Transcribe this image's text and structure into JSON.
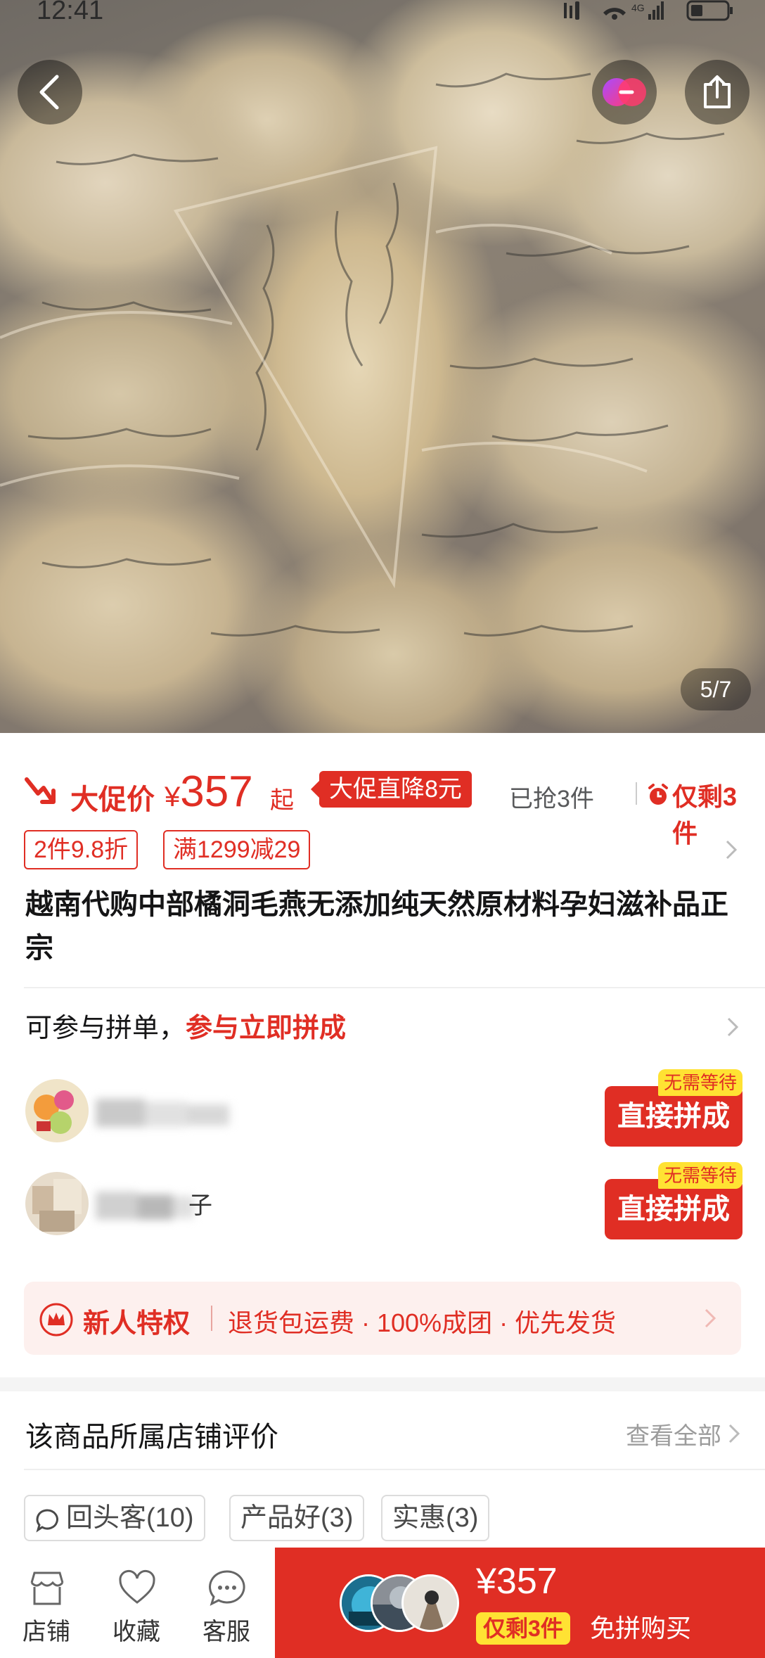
{
  "status_bar": {
    "time": "12:41"
  },
  "hero": {
    "page_indicator": "5/7"
  },
  "price": {
    "label": "大促价",
    "currency": "¥",
    "amount": "357",
    "suffix": "起",
    "promo_tag": "大促直降8元",
    "sold": "已抢3件",
    "remaining": "仅剩3件"
  },
  "coupons": [
    "2件9.8折",
    "满1299减29"
  ],
  "product_title": "越南代购中部橘洞毛燕无添加纯天然原材料孕妇滋补品正宗",
  "group_buy": {
    "label": "可参与拼单，",
    "action": "参与立即拼成",
    "members": [
      {
        "button": "直接拼成",
        "badge": "无需等待"
      },
      {
        "button": "直接拼成",
        "badge": "无需等待",
        "name_tail": "子"
      }
    ]
  },
  "new_user": {
    "title": "新人特权",
    "benefits": "退货包运费 · 100%成团 · 优先发货"
  },
  "reviews": {
    "title": "该商品所属店铺评价",
    "view_all": "查看全部",
    "tags": [
      "回头客(10)",
      "产品好(3)",
      "实惠(3)"
    ]
  },
  "bottom_bar": {
    "tabs": [
      "店铺",
      "收藏",
      "客服"
    ],
    "buy_price": "¥357",
    "buy_stock": "仅剩3件",
    "buy_label": "免拼购买"
  },
  "colors": {
    "accent": "#e02e24",
    "badge_yellow": "#ffe233"
  }
}
